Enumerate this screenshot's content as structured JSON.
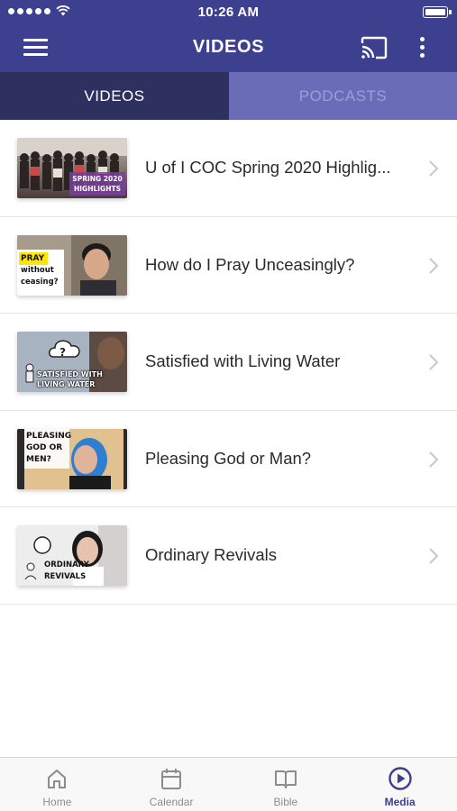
{
  "status_bar": {
    "time": "10:26 AM"
  },
  "header": {
    "title": "VIDEOS"
  },
  "tabs": [
    {
      "label": "VIDEOS",
      "active": true
    },
    {
      "label": "PODCASTS",
      "active": false
    }
  ],
  "videos": [
    {
      "title": "U of I COC Spring 2020 Highlig...",
      "thumb_text": [
        "SPRING 2020",
        "HIGHLIGHTS"
      ]
    },
    {
      "title": "How do I Pray Unceasingly?",
      "thumb_text": [
        "PRAY",
        "without",
        "ceasing?"
      ]
    },
    {
      "title": "Satisfied with Living Water",
      "thumb_text": [
        "SATISFIED WITH",
        "LIVING WATER"
      ]
    },
    {
      "title": "Pleasing God or Man?",
      "thumb_text": [
        "PLEASING",
        "GOD OR",
        "MEN?"
      ]
    },
    {
      "title": "Ordinary Revivals",
      "thumb_text": [
        "ORDINARY",
        "REVIVALS"
      ]
    }
  ],
  "bottom_nav": [
    {
      "label": "Home",
      "icon": "home-icon"
    },
    {
      "label": "Calendar",
      "icon": "calendar-icon"
    },
    {
      "label": "Bible",
      "icon": "book-icon"
    },
    {
      "label": "Media",
      "icon": "play-circle-icon",
      "active": true
    }
  ],
  "colors": {
    "primary": "#3d3f8f",
    "tab_active": "#2e3060",
    "tab_inactive": "#6b6cb8"
  }
}
